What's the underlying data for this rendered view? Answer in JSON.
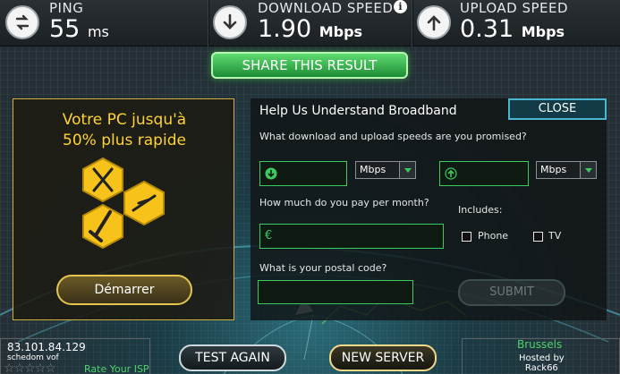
{
  "stats": {
    "ping": {
      "label": "PING",
      "value": "55",
      "unit": "ms"
    },
    "download": {
      "label": "DOWNLOAD SPEED",
      "value": "1.90",
      "unit": "Mbps"
    },
    "upload": {
      "label": "UPLOAD SPEED",
      "value": "0.31",
      "unit": "Mbps"
    }
  },
  "share_label": "SHARE THIS RESULT",
  "ad": {
    "line1": "Votre PC jusqu'à",
    "line2": "50% plus rapide",
    "button": "Démarrer"
  },
  "form": {
    "title": "Help Us Understand Broadband",
    "close": "CLOSE",
    "q_speeds": "What download and upload speeds are you promised?",
    "download_unit": "Mbps",
    "upload_unit": "Mbps",
    "q_pay": "How much do you pay per month?",
    "currency": "€",
    "includes": "Includes:",
    "phone": "Phone",
    "tv": "TV",
    "q_postal": "What is your postal code?",
    "submit": "SUBMIT"
  },
  "bottom": {
    "ip": "83.101.84.129",
    "isp": "schedom vof",
    "stars": "☆☆☆☆☆",
    "rate": "Rate Your ISP",
    "test_again": "TEST AGAIN",
    "new_server": "NEW SERVER",
    "city": "Brussels",
    "hosted_by": "Hosted by",
    "host": "Rack66"
  },
  "colors": {
    "accent_green": "#3ccb5e",
    "ad_yellow": "#ffd233",
    "close_blue": "#4ab6cf"
  }
}
